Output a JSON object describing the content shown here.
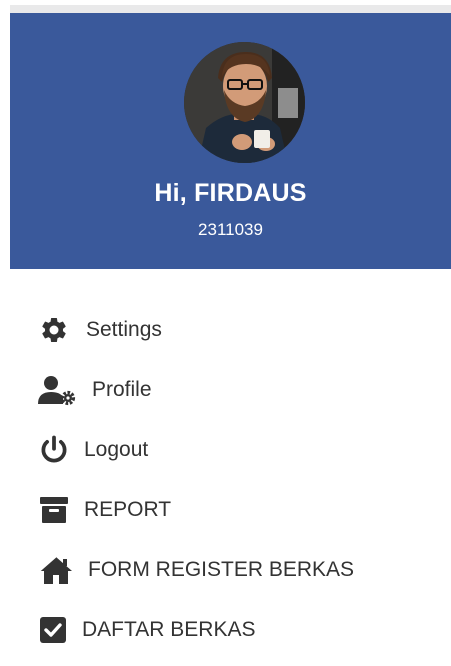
{
  "profile": {
    "greeting": "Hi, FIRDAUS",
    "user_id": "2311039"
  },
  "colors": {
    "header_bg": "#3a599b",
    "menu_text": "#333333"
  },
  "menu": {
    "items": [
      {
        "label": "Settings",
        "icon": "gear-icon"
      },
      {
        "label": "Profile",
        "icon": "user-gear-icon"
      },
      {
        "label": "Logout",
        "icon": "power-icon"
      },
      {
        "label": "REPORT",
        "icon": "archive-box-icon"
      },
      {
        "label": "FORM REGISTER BERKAS",
        "icon": "home-icon"
      },
      {
        "label": "DAFTAR BERKAS",
        "icon": "checkbox-icon"
      }
    ]
  }
}
